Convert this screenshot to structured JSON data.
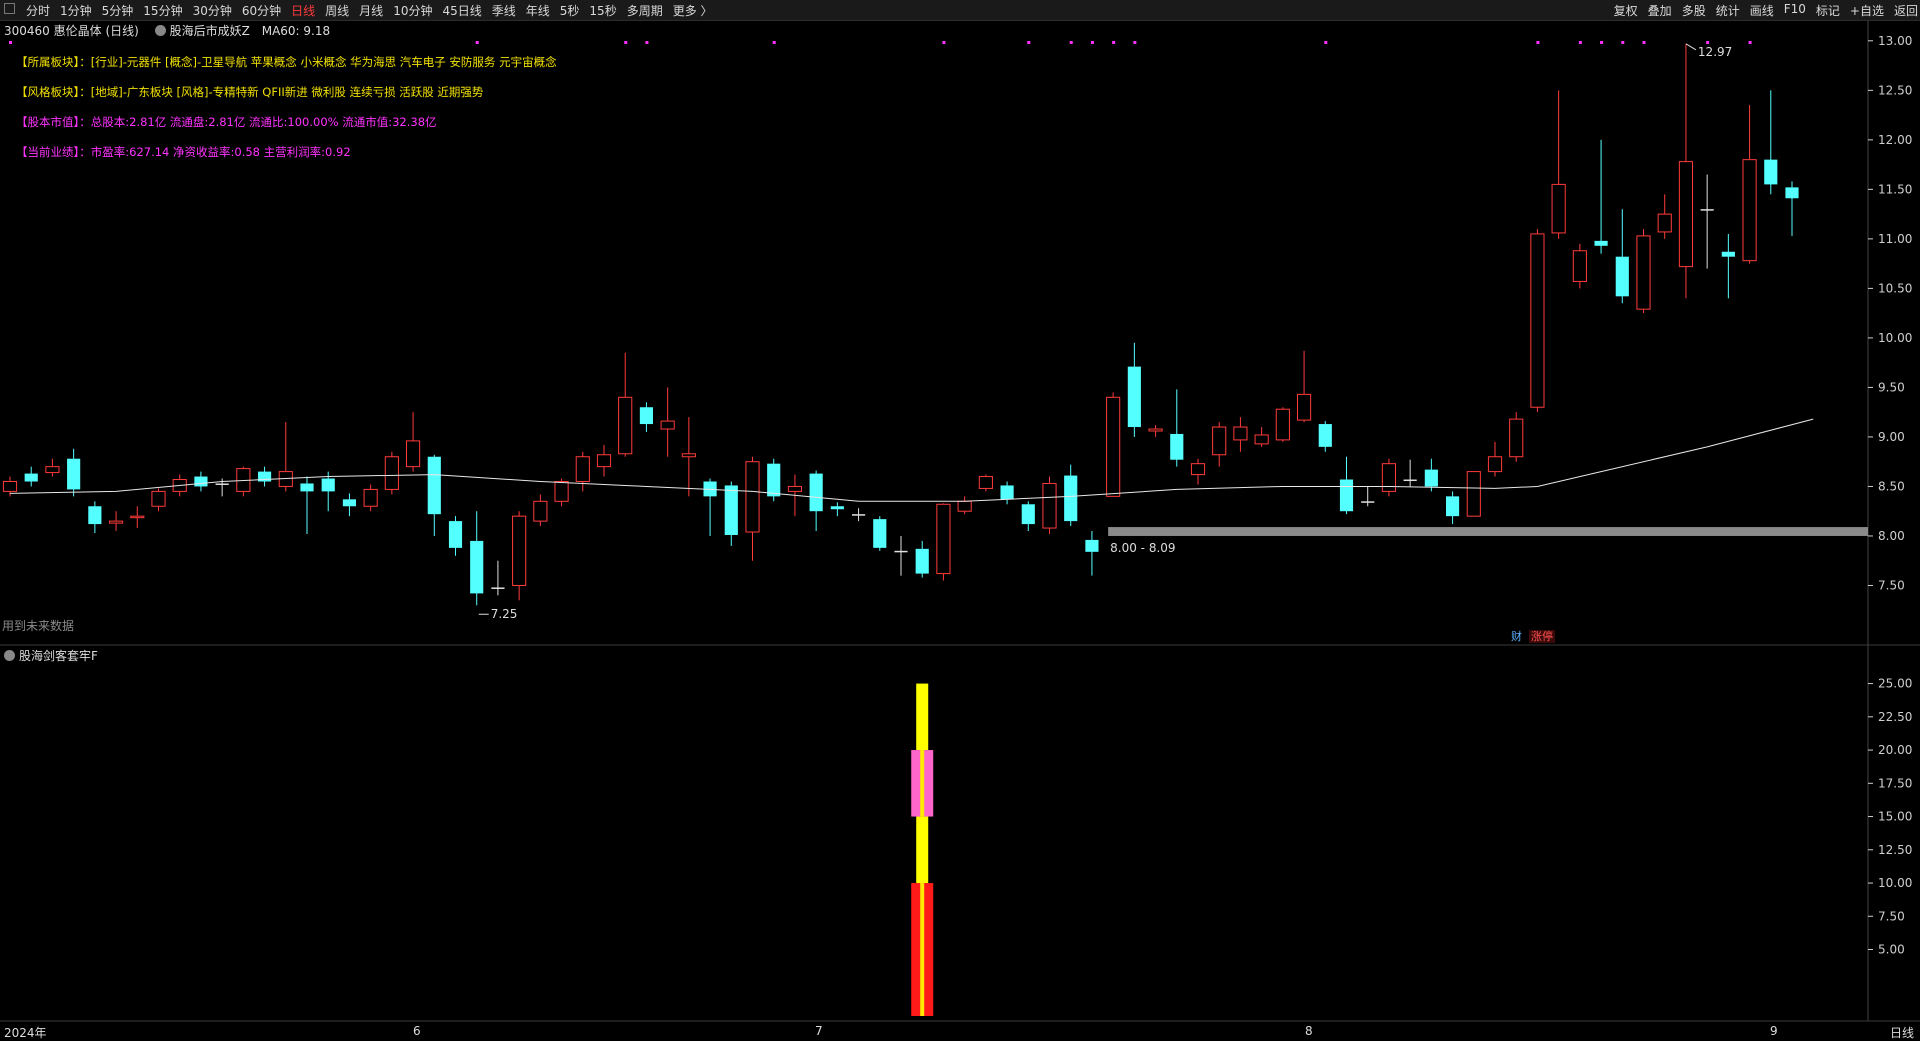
{
  "topbar": {
    "periods": [
      "分时",
      "1分钟",
      "5分钟",
      "15分钟",
      "30分钟",
      "60分钟",
      "日线",
      "周线",
      "月线",
      "10分钟",
      "45日线",
      "季线",
      "年线",
      "5秒",
      "15秒",
      "多周期",
      "更多 〉"
    ],
    "active_period": "日线",
    "tools": [
      "复权",
      "叠加",
      "多股",
      "统计",
      "画线",
      "F10",
      "标记",
      "+自选",
      "返回"
    ]
  },
  "stock": {
    "code": "300460",
    "name": "惠伦晶体 (日线)",
    "indicator": "股海后市成妖Z",
    "ma_label": "MA60: 9.18"
  },
  "info_tags": [
    {
      "label": "【所属板块】：",
      "text": "[行业]-元器件 [概念]-卫星导航 苹果概念 小米概念 华为海思 汽车电子 安防服务 元宇宙概念",
      "color": "#f0e000"
    },
    {
      "label": "【风格板块】：",
      "text": "[地域]-广东板块 [风格]-专精特新 QFII新进 微利股 连续亏损 活跃股 近期强势",
      "color": "#f0e000"
    },
    {
      "label": "【股本市值】：",
      "text": "总股本:2.81亿 流通盘:2.81亿 流通比:100.00% 流通市值:32.38亿",
      "color": "#ff33ff"
    },
    {
      "label": "【当前业绩】：",
      "text": "市盈率:627.14 净资收益率:0.58 主营利润率:0.92",
      "color": "#ff33ff"
    }
  ],
  "future_note": "用到未来数据",
  "badges": {
    "fin": "财",
    "limit": "涨停"
  },
  "sub_panel": {
    "title": "股海剑客套牢F"
  },
  "timeline": {
    "year": "2024年",
    "months": [
      "6",
      "7",
      "8",
      "9"
    ],
    "period": "日线"
  },
  "colors": {
    "up": "#ff3b3b",
    "down": "#54ffff",
    "ma": "#e8e8e8",
    "axis": "#cfcfcf",
    "zone": "#8a8a8a"
  },
  "chart_data": [
    {
      "type": "candlestick",
      "title": "",
      "ylim": [
        7.0,
        13.2
      ],
      "y_ticks": [
        13.0,
        12.5,
        12.0,
        11.5,
        11.0,
        10.5,
        10.0,
        9.5,
        9.0,
        8.5,
        8.0,
        7.5
      ],
      "annotations": {
        "high": "12.97",
        "low": "7.25",
        "zone": "8.00 - 8.09"
      },
      "candles": [
        {
          "o": 8.45,
          "c": 8.55,
          "h": 8.6,
          "l": 8.4
        },
        {
          "o": 8.63,
          "c": 8.55,
          "h": 8.7,
          "l": 8.5
        },
        {
          "o": 8.64,
          "c": 8.7,
          "h": 8.78,
          "l": 8.6
        },
        {
          "o": 8.78,
          "c": 8.47,
          "h": 8.88,
          "l": 8.4
        },
        {
          "o": 8.3,
          "c": 8.12,
          "h": 8.35,
          "l": 8.03
        },
        {
          "o": 8.13,
          "c": 8.15,
          "h": 8.25,
          "l": 8.05
        },
        {
          "o": 8.19,
          "c": 8.2,
          "h": 8.3,
          "l": 8.08
        },
        {
          "o": 8.3,
          "c": 8.45,
          "h": 8.48,
          "l": 8.25
        },
        {
          "o": 8.45,
          "c": 8.57,
          "h": 8.62,
          "l": 8.4
        },
        {
          "o": 8.6,
          "c": 8.5,
          "h": 8.65,
          "l": 8.45
        },
        {
          "o": 8.53,
          "c": 8.53,
          "h": 8.58,
          "l": 8.4
        },
        {
          "o": 8.45,
          "c": 8.68,
          "h": 8.7,
          "l": 8.4
        },
        {
          "o": 8.65,
          "c": 8.55,
          "h": 8.7,
          "l": 8.5
        },
        {
          "o": 8.5,
          "c": 8.65,
          "h": 9.15,
          "l": 8.45
        },
        {
          "o": 8.53,
          "c": 8.45,
          "h": 8.6,
          "l": 8.02
        },
        {
          "o": 8.58,
          "c": 8.45,
          "h": 8.65,
          "l": 8.25
        },
        {
          "o": 8.37,
          "c": 8.3,
          "h": 8.43,
          "l": 8.2
        },
        {
          "o": 8.3,
          "c": 8.47,
          "h": 8.52,
          "l": 8.25
        },
        {
          "o": 8.47,
          "c": 8.8,
          "h": 8.85,
          "l": 8.42
        },
        {
          "o": 8.7,
          "c": 8.96,
          "h": 9.25,
          "l": 8.65
        },
        {
          "o": 8.8,
          "c": 8.22,
          "h": 8.82,
          "l": 8.0
        },
        {
          "o": 8.15,
          "c": 7.88,
          "h": 8.2,
          "l": 7.8
        },
        {
          "o": 7.95,
          "c": 7.42,
          "h": 8.25,
          "l": 7.3
        },
        {
          "o": 7.48,
          "c": 7.48,
          "h": 7.75,
          "l": 7.4
        },
        {
          "o": 7.5,
          "c": 8.2,
          "h": 8.25,
          "l": 7.35
        },
        {
          "o": 8.15,
          "c": 8.35,
          "h": 8.42,
          "l": 8.1
        },
        {
          "o": 8.35,
          "c": 8.55,
          "h": 8.58,
          "l": 8.3
        },
        {
          "o": 8.55,
          "c": 8.8,
          "h": 8.85,
          "l": 8.45
        },
        {
          "o": 8.7,
          "c": 8.82,
          "h": 8.92,
          "l": 8.6
        },
        {
          "o": 8.83,
          "c": 9.4,
          "h": 9.85,
          "l": 8.8
        },
        {
          "o": 9.3,
          "c": 9.13,
          "h": 9.35,
          "l": 9.05
        },
        {
          "o": 9.08,
          "c": 9.16,
          "h": 9.5,
          "l": 8.8
        },
        {
          "o": 8.8,
          "c": 8.83,
          "h": 9.2,
          "l": 8.4
        },
        {
          "o": 8.55,
          "c": 8.4,
          "h": 8.58,
          "l": 8.0
        },
        {
          "o": 8.51,
          "c": 8.01,
          "h": 8.55,
          "l": 7.9
        },
        {
          "o": 8.04,
          "c": 8.75,
          "h": 8.8,
          "l": 7.75
        },
        {
          "o": 8.73,
          "c": 8.4,
          "h": 8.78,
          "l": 8.35
        },
        {
          "o": 8.45,
          "c": 8.5,
          "h": 8.62,
          "l": 8.2
        },
        {
          "o": 8.63,
          "c": 8.25,
          "h": 8.66,
          "l": 8.05
        },
        {
          "o": 8.3,
          "c": 8.27,
          "h": 8.34,
          "l": 8.2
        },
        {
          "o": 8.22,
          "c": 8.22,
          "h": 8.28,
          "l": 8.15
        },
        {
          "o": 8.17,
          "c": 7.88,
          "h": 8.2,
          "l": 7.85
        },
        {
          "o": 7.85,
          "c": 7.85,
          "h": 8.0,
          "l": 7.6
        },
        {
          "o": 7.87,
          "c": 7.62,
          "h": 7.95,
          "l": 7.58
        },
        {
          "o": 7.62,
          "c": 8.32,
          "h": 8.33,
          "l": 7.55
        },
        {
          "o": 8.25,
          "c": 8.35,
          "h": 8.4,
          "l": 8.22
        },
        {
          "o": 8.48,
          "c": 8.6,
          "h": 8.62,
          "l": 8.45
        },
        {
          "o": 8.51,
          "c": 8.37,
          "h": 8.55,
          "l": 8.32
        },
        {
          "o": 8.32,
          "c": 8.12,
          "h": 8.35,
          "l": 8.05
        },
        {
          "o": 8.08,
          "c": 8.53,
          "h": 8.6,
          "l": 8.02
        },
        {
          "o": 8.61,
          "c": 8.15,
          "h": 8.72,
          "l": 8.1
        },
        {
          "o": 7.96,
          "c": 7.84,
          "h": 8.05,
          "l": 7.6
        },
        {
          "o": 8.4,
          "c": 9.4,
          "h": 9.45,
          "l": 8.4
        },
        {
          "o": 9.71,
          "c": 9.1,
          "h": 9.95,
          "l": 9.0
        },
        {
          "o": 9.06,
          "c": 9.08,
          "h": 9.12,
          "l": 9.0
        },
        {
          "o": 9.03,
          "c": 8.77,
          "h": 9.48,
          "l": 8.7
        },
        {
          "o": 8.62,
          "c": 8.73,
          "h": 8.78,
          "l": 8.52
        },
        {
          "o": 8.82,
          "c": 9.1,
          "h": 9.15,
          "l": 8.7
        },
        {
          "o": 8.97,
          "c": 9.1,
          "h": 9.2,
          "l": 8.85
        },
        {
          "o": 8.93,
          "c": 9.02,
          "h": 9.1,
          "l": 8.9
        },
        {
          "o": 8.97,
          "c": 9.28,
          "h": 9.3,
          "l": 8.95
        },
        {
          "o": 9.17,
          "c": 9.43,
          "h": 9.87,
          "l": 9.15
        },
        {
          "o": 9.13,
          "c": 8.9,
          "h": 9.16,
          "l": 8.85
        },
        {
          "o": 8.57,
          "c": 8.25,
          "h": 8.8,
          "l": 8.22
        },
        {
          "o": 8.35,
          "c": 8.35,
          "h": 8.5,
          "l": 8.3
        },
        {
          "o": 8.45,
          "c": 8.73,
          "h": 8.78,
          "l": 8.4
        },
        {
          "o": 8.57,
          "c": 8.57,
          "h": 8.77,
          "l": 8.5
        },
        {
          "o": 8.67,
          "c": 8.5,
          "h": 8.78,
          "l": 8.45
        },
        {
          "o": 8.4,
          "c": 8.2,
          "h": 8.45,
          "l": 8.12
        },
        {
          "o": 8.2,
          "c": 8.65,
          "h": 8.65,
          "l": 8.2
        },
        {
          "o": 8.65,
          "c": 8.8,
          "h": 8.95,
          "l": 8.6
        },
        {
          "o": 8.8,
          "c": 9.18,
          "h": 9.25,
          "l": 8.75
        },
        {
          "o": 9.3,
          "c": 11.05,
          "h": 11.1,
          "l": 9.25
        },
        {
          "o": 11.06,
          "c": 11.55,
          "h": 12.5,
          "l": 11.0
        },
        {
          "o": 10.57,
          "c": 10.88,
          "h": 10.95,
          "l": 10.5
        },
        {
          "o": 10.98,
          "c": 10.93,
          "h": 12.0,
          "l": 10.85
        },
        {
          "o": 10.82,
          "c": 10.42,
          "h": 11.3,
          "l": 10.35
        },
        {
          "o": 10.29,
          "c": 11.03,
          "h": 11.1,
          "l": 10.25
        },
        {
          "o": 11.07,
          "c": 11.25,
          "h": 11.45,
          "l": 11.0
        },
        {
          "o": 10.72,
          "c": 11.78,
          "h": 12.97,
          "l": 10.4
        },
        {
          "o": 11.3,
          "c": 11.3,
          "h": 11.65,
          "l": 10.7
        },
        {
          "o": 10.87,
          "c": 10.82,
          "h": 11.05,
          "l": 10.4
        },
        {
          "o": 10.78,
          "c": 11.8,
          "h": 12.35,
          "l": 10.75
        },
        {
          "o": 11.8,
          "c": 11.55,
          "h": 12.5,
          "l": 11.45
        },
        {
          "o": 11.52,
          "c": 11.41,
          "h": 11.58,
          "l": 11.03
        }
      ],
      "ma60": [
        [
          0,
          8.43
        ],
        [
          5,
          8.45
        ],
        [
          10,
          8.55
        ],
        [
          15,
          8.6
        ],
        [
          20,
          8.62
        ],
        [
          25,
          8.55
        ],
        [
          30,
          8.5
        ],
        [
          35,
          8.45
        ],
        [
          40,
          8.35
        ],
        [
          45,
          8.35
        ],
        [
          50,
          8.4
        ],
        [
          55,
          8.47
        ],
        [
          60,
          8.5
        ],
        [
          65,
          8.5
        ],
        [
          70,
          8.48
        ],
        [
          72,
          8.5
        ],
        [
          75,
          8.65
        ],
        [
          80,
          8.9
        ],
        [
          85,
          9.18
        ]
      ],
      "support_zone": [
        8.0,
        8.09
      ]
    },
    {
      "type": "bar",
      "title": "",
      "ylim": [
        0,
        27.6
      ],
      "y_ticks": [
        25.0,
        22.5,
        20.0,
        17.5,
        15.0,
        12.5,
        10.0,
        7.5,
        5.0
      ],
      "bar_index": 43,
      "stack": [
        {
          "from": 0,
          "to": 10.0,
          "color": "#ff1a1a",
          "core": "#ffea00"
        },
        {
          "from": 10.0,
          "to": 15.0,
          "color": "#ffff00"
        },
        {
          "from": 15.0,
          "to": 20.0,
          "color": "#ff66cc",
          "core": "#ffea00"
        },
        {
          "from": 20.0,
          "to": 25.0,
          "color": "#ffff00"
        }
      ]
    }
  ]
}
